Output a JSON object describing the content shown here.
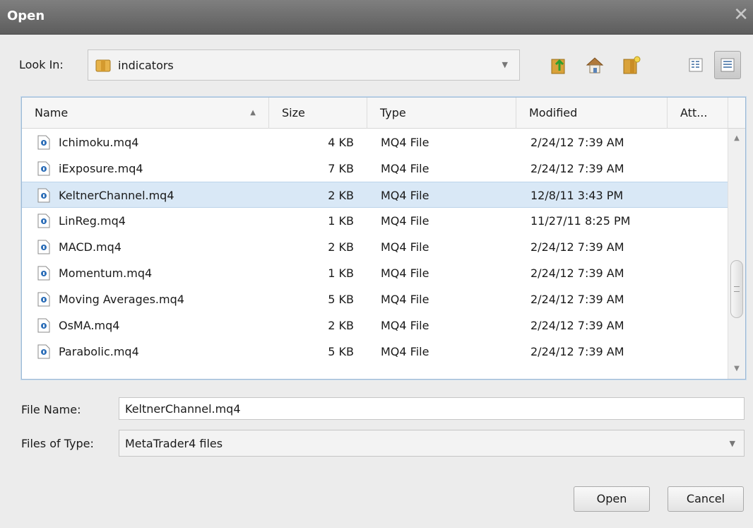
{
  "window": {
    "title": "Open"
  },
  "look_in": {
    "label": "Look In:",
    "value": "indicators"
  },
  "toolbar": {
    "icons": [
      "up-folder-icon",
      "home-icon",
      "new-folder-icon",
      "list-view-icon",
      "details-view-icon"
    ]
  },
  "columns": [
    "Name",
    "Size",
    "Type",
    "Modified",
    "Att..."
  ],
  "files": [
    {
      "name": "Ichimoku.mq4",
      "size": "4 KB",
      "type": "MQ4 File",
      "modified": "2/24/12 7:39 AM"
    },
    {
      "name": "iExposure.mq4",
      "size": "7 KB",
      "type": "MQ4 File",
      "modified": "2/24/12 7:39 AM"
    },
    {
      "name": "KeltnerChannel.mq4",
      "size": "2 KB",
      "type": "MQ4 File",
      "modified": "12/8/11 3:43 PM"
    },
    {
      "name": "LinReg.mq4",
      "size": "1 KB",
      "type": "MQ4 File",
      "modified": "11/27/11 8:25 PM"
    },
    {
      "name": "MACD.mq4",
      "size": "2 KB",
      "type": "MQ4 File",
      "modified": "2/24/12 7:39 AM"
    },
    {
      "name": "Momentum.mq4",
      "size": "1 KB",
      "type": "MQ4 File",
      "modified": "2/24/12 7:39 AM"
    },
    {
      "name": "Moving Averages.mq4",
      "size": "5 KB",
      "type": "MQ4 File",
      "modified": "2/24/12 7:39 AM"
    },
    {
      "name": "OsMA.mq4",
      "size": "2 KB",
      "type": "MQ4 File",
      "modified": "2/24/12 7:39 AM"
    },
    {
      "name": "Parabolic.mq4",
      "size": "5 KB",
      "type": "MQ4 File",
      "modified": "2/24/12 7:39 AM"
    }
  ],
  "selected_file": "KeltnerChannel.mq4",
  "file_name": {
    "label": "File Name:",
    "value": "KeltnerChannel.mq4"
  },
  "file_type": {
    "label": "Files of Type:",
    "value": "MetaTrader4 files"
  },
  "buttons": {
    "open": "Open",
    "cancel": "Cancel"
  },
  "colors": {
    "title_bar": "#6e6e6e",
    "selection": "#d9e8f6",
    "list_border": "#9db9d4"
  }
}
